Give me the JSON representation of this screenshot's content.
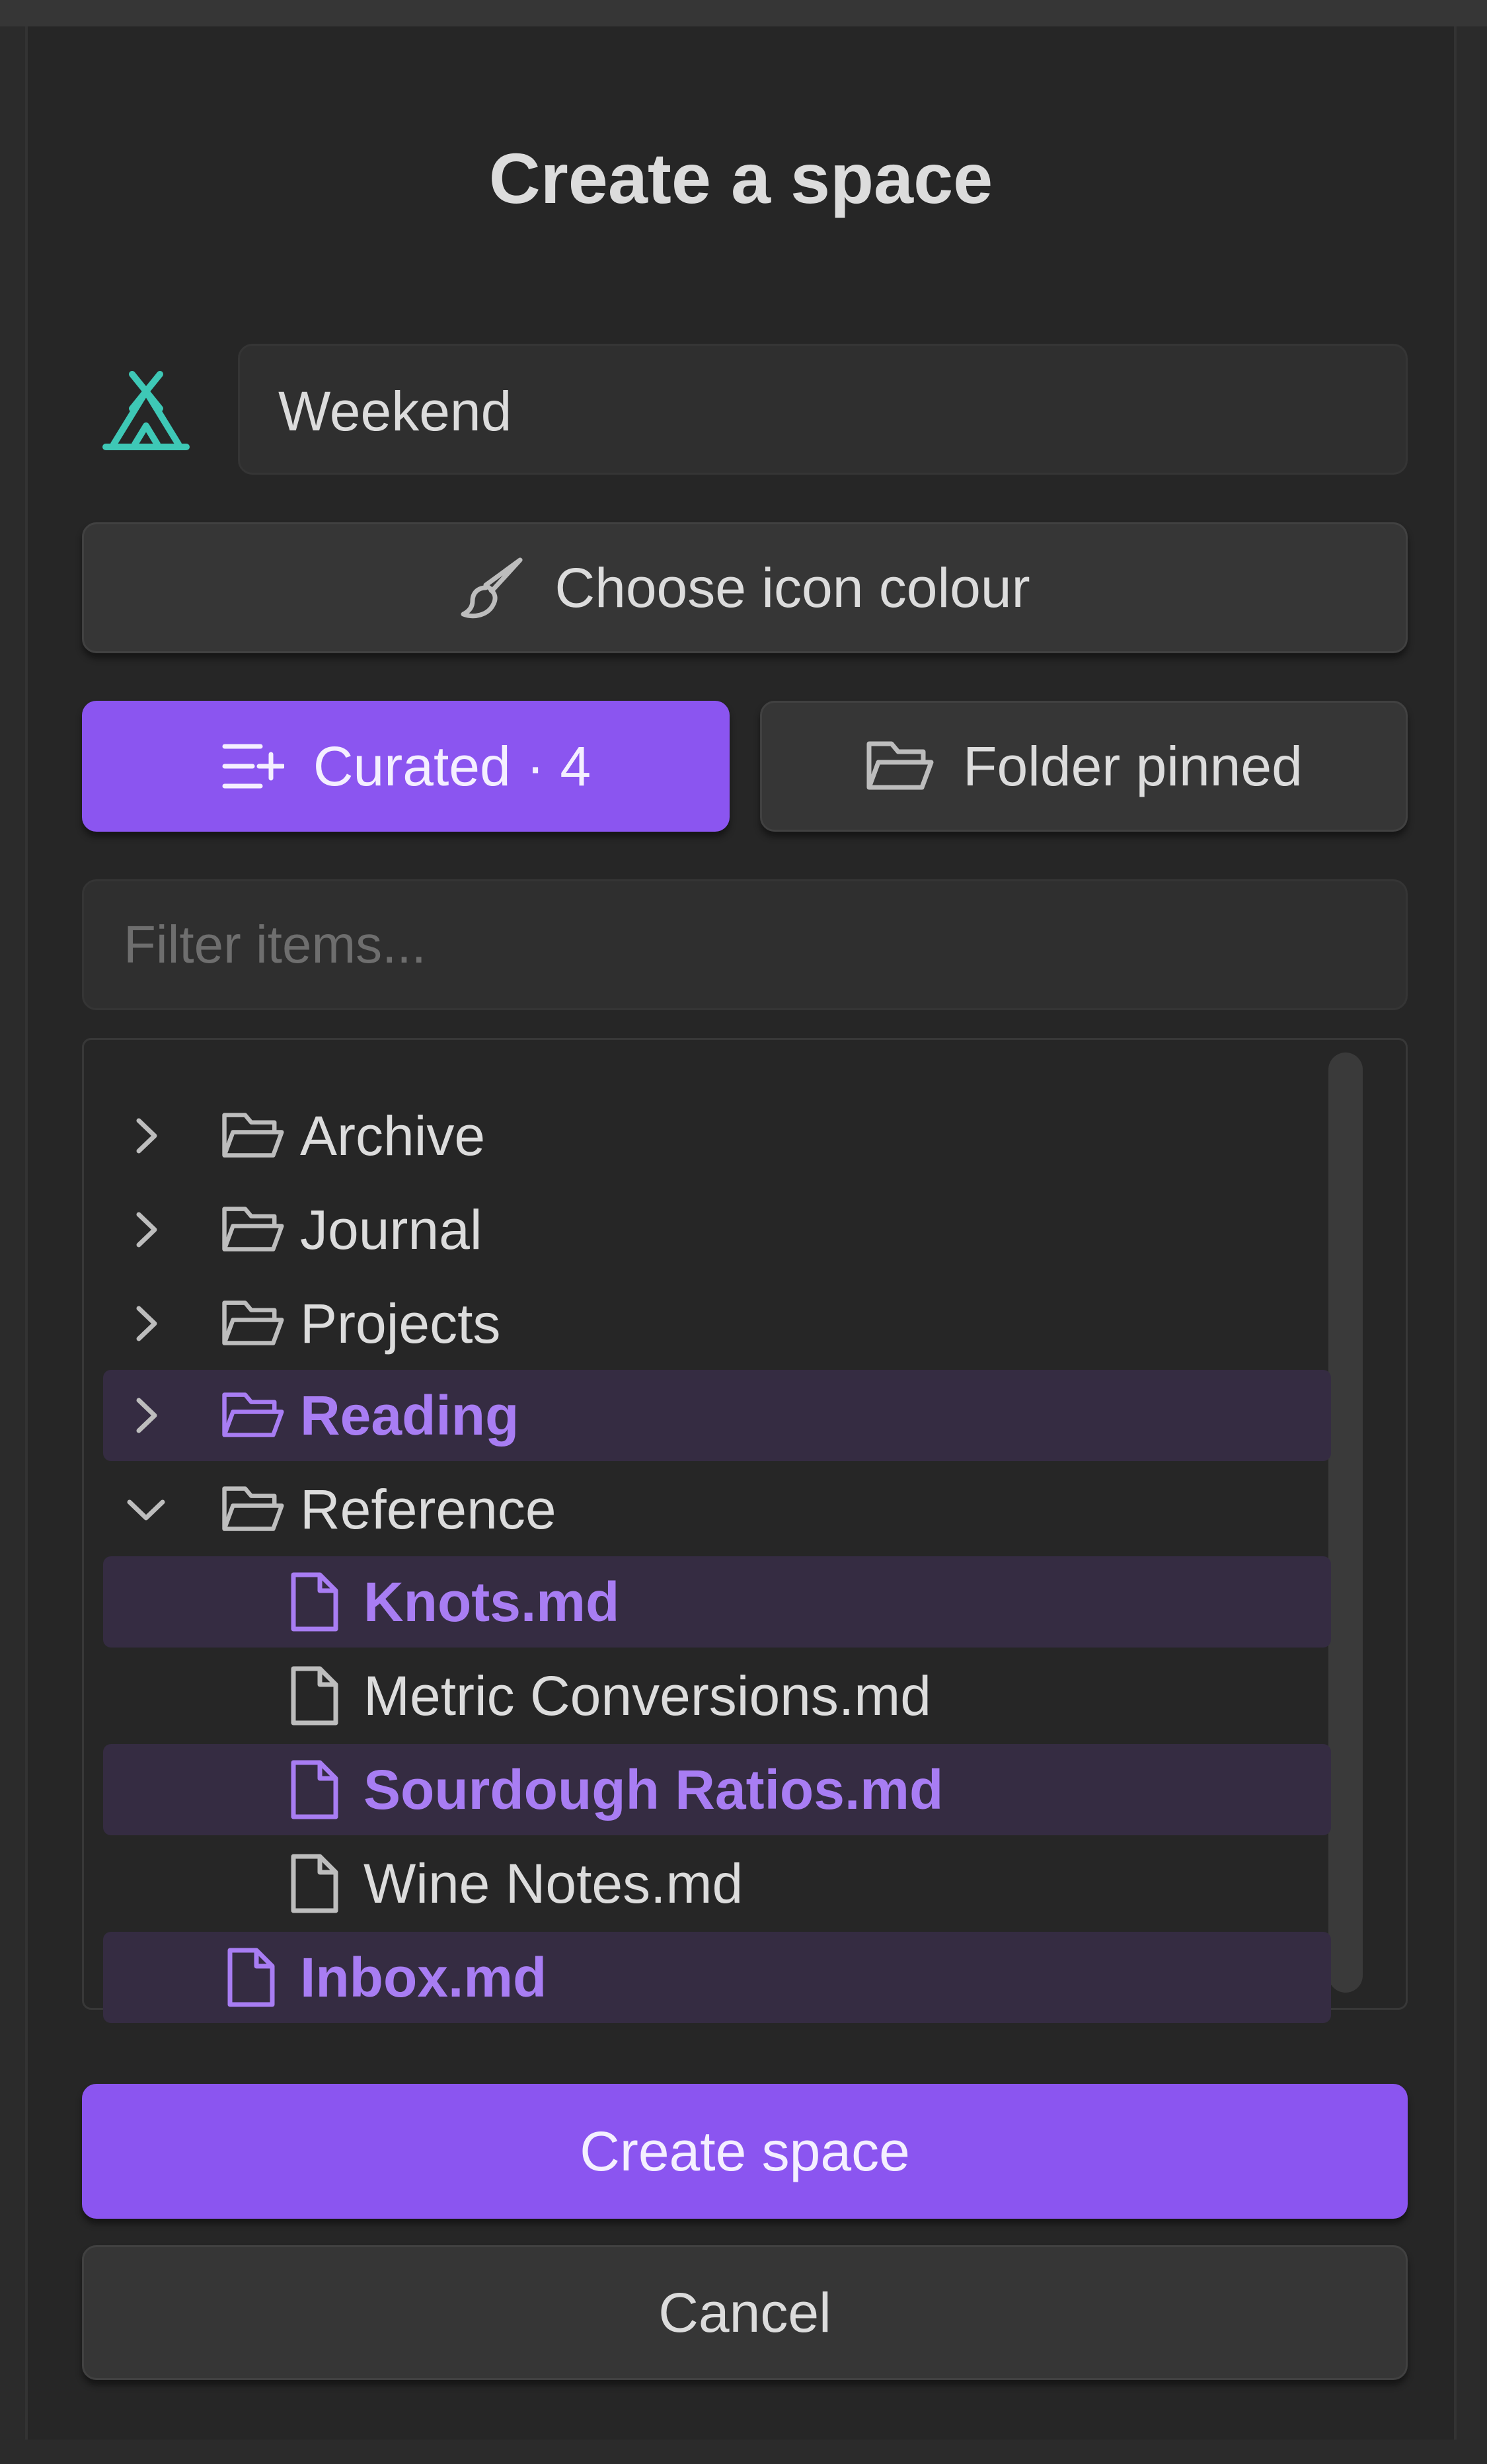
{
  "dialog": {
    "title": "Create a space",
    "name_value": "Weekend",
    "icon_name": "tent-icon",
    "icon_color": "#3ec8b6",
    "accent_color": "#8b55f0"
  },
  "buttons": {
    "choose_colour": "Choose icon colour",
    "curated": "Curated · 4",
    "folder_pinned": "Folder pinned",
    "create": "Create space",
    "cancel": "Cancel"
  },
  "filter": {
    "placeholder": "Filter items..."
  },
  "tree": {
    "items": [
      {
        "label": "Archive",
        "type": "folder",
        "expanded": false,
        "selected": false,
        "depth": 0
      },
      {
        "label": "Journal",
        "type": "folder",
        "expanded": false,
        "selected": false,
        "depth": 0
      },
      {
        "label": "Projects",
        "type": "folder",
        "expanded": false,
        "selected": false,
        "depth": 0
      },
      {
        "label": "Reading",
        "type": "folder",
        "expanded": false,
        "selected": true,
        "depth": 0
      },
      {
        "label": "Reference",
        "type": "folder",
        "expanded": true,
        "selected": false,
        "depth": 0
      },
      {
        "label": "Knots.md",
        "type": "file",
        "selected": true,
        "depth": 1
      },
      {
        "label": "Metric Conversions.md",
        "type": "file",
        "selected": false,
        "depth": 1
      },
      {
        "label": "Sourdough Ratios.md",
        "type": "file",
        "selected": true,
        "depth": 1
      },
      {
        "label": "Wine Notes.md",
        "type": "file",
        "selected": false,
        "depth": 1
      },
      {
        "label": "Inbox.md",
        "type": "file",
        "selected": true,
        "depth": 0
      }
    ]
  }
}
